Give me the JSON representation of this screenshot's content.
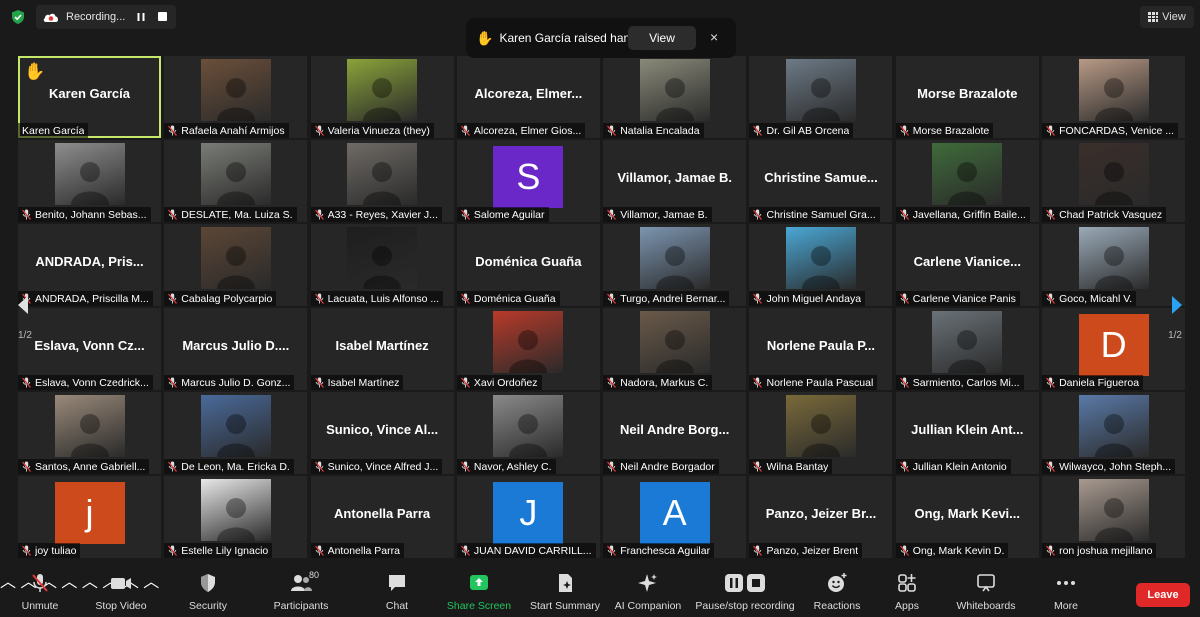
{
  "recording": {
    "label": "Recording..."
  },
  "view": {
    "label": "View"
  },
  "notification": {
    "message": "Karen García raised hand",
    "view_label": "View",
    "close_label": "×"
  },
  "pager": {
    "left": "1/2",
    "right": "1/2"
  },
  "participants": [
    {
      "label": "Karen García",
      "big": "Karen García",
      "type": "name",
      "hand": true,
      "muted": false
    },
    {
      "label": "Rafaela Anahí Armijos",
      "type": "photo",
      "bg": "#6b4f3a"
    },
    {
      "label": "Valeria Vinueza (they)",
      "type": "photo",
      "bg": "#8aa33a"
    },
    {
      "label": "Alcoreza, Elmer Gios...",
      "big": "Alcoreza,  Elmer...",
      "type": "name"
    },
    {
      "label": "Natalia Encalada",
      "type": "photo",
      "bg": "#8a8a7a"
    },
    {
      "label": "Dr. Gil AB Orcena",
      "type": "photo",
      "bg": "#6d7a86"
    },
    {
      "label": "Morse Brazalote",
      "big": "Morse Brazalote",
      "type": "name"
    },
    {
      "label": "FONCARDAS, Venice ...",
      "type": "photo",
      "bg": "#b89a86"
    },
    {
      "label": "Benito, Johann Sebas...",
      "type": "photo",
      "bg": "#8e8e8e"
    },
    {
      "label": "DESLATE, Ma. Luiza S.",
      "type": "photo",
      "bg": "#7a7d76"
    },
    {
      "label": "A33 - Reyes, Xavier J...",
      "type": "photo",
      "bg": "#6f6b66"
    },
    {
      "label": "Salome Aguilar",
      "type": "avatar",
      "letter": "S",
      "bg": "#6a28c8"
    },
    {
      "label": "Villamor, Jamae B.",
      "big": "Villamor, Jamae B.",
      "type": "name"
    },
    {
      "label": "Christine Samuel Gra...",
      "big": "Christine  Samue...",
      "type": "name"
    },
    {
      "label": "Javellana, Griffin Baile...",
      "type": "photo",
      "bg": "#3f6b3a"
    },
    {
      "label": "Chad Patrick Vasquez",
      "type": "photo",
      "bg": "#3a2e2a"
    },
    {
      "label": "ANDRADA, Priscilla M...",
      "big": "ANDRADA,  Pris...",
      "type": "name"
    },
    {
      "label": "Cabalag Polycarpio",
      "type": "photo",
      "bg": "#5c4636"
    },
    {
      "label": "Lacuata, Luis Alfonso ...",
      "type": "photo",
      "bg": "#1e1e1e"
    },
    {
      "label": "Doménica Guaña",
      "big": "Doménica Guaña",
      "type": "name"
    },
    {
      "label": "Turgo, Andrei Bernar...",
      "type": "photo",
      "bg": "#7c95b0"
    },
    {
      "label": "John Miguel Andaya",
      "type": "photo",
      "bg": "#4aa8d6"
    },
    {
      "label": "Carlene Vianice Panis",
      "big": "Carlene  Vianice...",
      "type": "name"
    },
    {
      "label": "Goco, Micahl V.",
      "type": "photo",
      "bg": "#9aaab8"
    },
    {
      "label": "Eslava, Vonn Czedrick...",
      "big": "Eslava,  Vonn  Cz...",
      "type": "name"
    },
    {
      "label": "Marcus Julio D. Gonz...",
      "big": "Marcus  Julio  D....",
      "type": "name"
    },
    {
      "label": "Isabel Martínez",
      "big": "Isabel Martínez",
      "type": "name"
    },
    {
      "label": "Xavi Ordoñez",
      "type": "photo",
      "bg": "#b83a2a"
    },
    {
      "label": "Nadora, Markus C.",
      "type": "photo",
      "bg": "#6a5a4a"
    },
    {
      "label": "Norlene Paula Pascual",
      "big": "Norlene  Paula  P...",
      "type": "name"
    },
    {
      "label": "Sarmiento, Carlos Mi...",
      "type": "photo",
      "bg": "#6a7278"
    },
    {
      "label": "Daniela Figueroa",
      "type": "avatar",
      "letter": "D",
      "bg": "#cc4a1c"
    },
    {
      "label": "Santos, Anne Gabriell...",
      "type": "photo",
      "bg": "#9a8a7a"
    },
    {
      "label": "De Leon, Ma. Ericka D.",
      "type": "photo",
      "bg": "#4a6a9a"
    },
    {
      "label": "Sunico, Vince Alfred J...",
      "big": "Sunico,  Vince  Al...",
      "type": "name"
    },
    {
      "label": "Navor, Ashley C.",
      "type": "photo",
      "bg": "#8a8a8a"
    },
    {
      "label": "Neil Andre Borgador",
      "big": "Neil Andre  Borg...",
      "type": "name"
    },
    {
      "label": "Wilna Bantay",
      "type": "photo",
      "bg": "#7a6a3a"
    },
    {
      "label": "Jullian Klein Antonio",
      "big": "Jullian Klein  Ant...",
      "type": "name"
    },
    {
      "label": "Wilwayco, John Steph...",
      "type": "photo",
      "bg": "#5a7aa8"
    },
    {
      "label": "joy tuliao",
      "type": "avatar",
      "letter": "j",
      "bg": "#cc4a1c"
    },
    {
      "label": "Estelle Lily Ignacio",
      "type": "photo",
      "bg": "#e8e8e8"
    },
    {
      "label": "Antonella Parra",
      "big": "Antonella Parra",
      "type": "name"
    },
    {
      "label": "JUAN DAVID CARRILL...",
      "type": "avatar",
      "letter": "J",
      "bg": "#1a7ad6"
    },
    {
      "label": "Franchesca Aguilar",
      "type": "avatar",
      "letter": "A",
      "bg": "#1a7ad6"
    },
    {
      "label": "Panzo, Jeizer Brent",
      "big": "Panzo,  Jeizer  Br...",
      "type": "name"
    },
    {
      "label": "Ong, Mark Kevin D.",
      "big": "Ong,  Mark  Kevi...",
      "type": "name"
    },
    {
      "label": "ron joshua mejillano",
      "type": "photo",
      "bg": "#a89a90"
    }
  ],
  "toolbar": {
    "unmute": "Unmute",
    "stop_video": "Stop Video",
    "security": "Security",
    "participants": "Participants",
    "participants_count": "80",
    "chat": "Chat",
    "share_screen": "Share Screen",
    "start_summary": "Start Summary",
    "ai_companion": "AI Companion",
    "pause_stop": "Pause/stop recording",
    "reactions": "Reactions",
    "apps": "Apps",
    "whiteboards": "Whiteboards",
    "more": "More",
    "leave": "Leave"
  },
  "colors": {
    "active_speaker": "#c5e86b",
    "share_green": "#22c55e",
    "leave_red": "#e02828",
    "mute_red": "#e03a3a"
  }
}
